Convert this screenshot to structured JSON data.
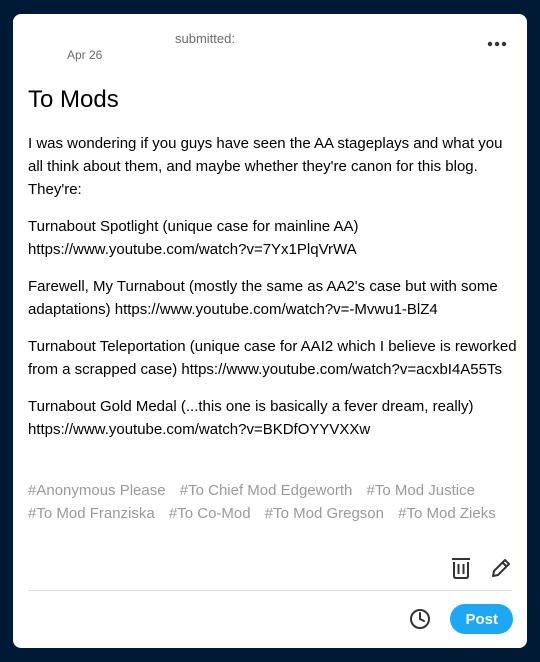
{
  "post": {
    "date": "Apr 26",
    "submitted_label": "submitted:",
    "title": "To Mods",
    "paragraphs": [
      "I was wondering if you guys have seen the AA stageplays and what you all think about them, and maybe whether they're canon for this blog. They're:",
      "Turnabout Spotlight (unique case for mainline AA) https://www.youtube.com/watch?v=7Yx1PlqVrWA",
      "Farewell, My Turnabout (mostly the same as AA2's case but with some adaptations) https://www.youtube.com/watch?v=-Mvwu1-BlZ4",
      "Turnabout Teleportation (unique case for AAI2 which I believe is reworked from a scrapped case) https://www.youtube.com/watch?v=acxbI4A55Ts",
      "Turnabout Gold Medal (...this one is basically a fever dream, really) https://www.youtube.com/watch?v=BKDfOYYVXXw"
    ],
    "tags": [
      "#Anonymous Please",
      "#To Chief Mod Edgeworth",
      "#To Mod Justice",
      "#To Mod Franziska",
      "#To Co-Mod",
      "#To Mod Gregson",
      "#To Mod Zieks"
    ]
  },
  "icons": {
    "more": "more-horizontal-icon",
    "delete": "trash-icon",
    "edit": "pencil-icon",
    "schedule": "clock-icon"
  },
  "actions": {
    "post_label": "Post"
  },
  "colors": {
    "background": "#001935",
    "accent": "#1ea7f2",
    "tag_text": "#9a9a9a"
  }
}
